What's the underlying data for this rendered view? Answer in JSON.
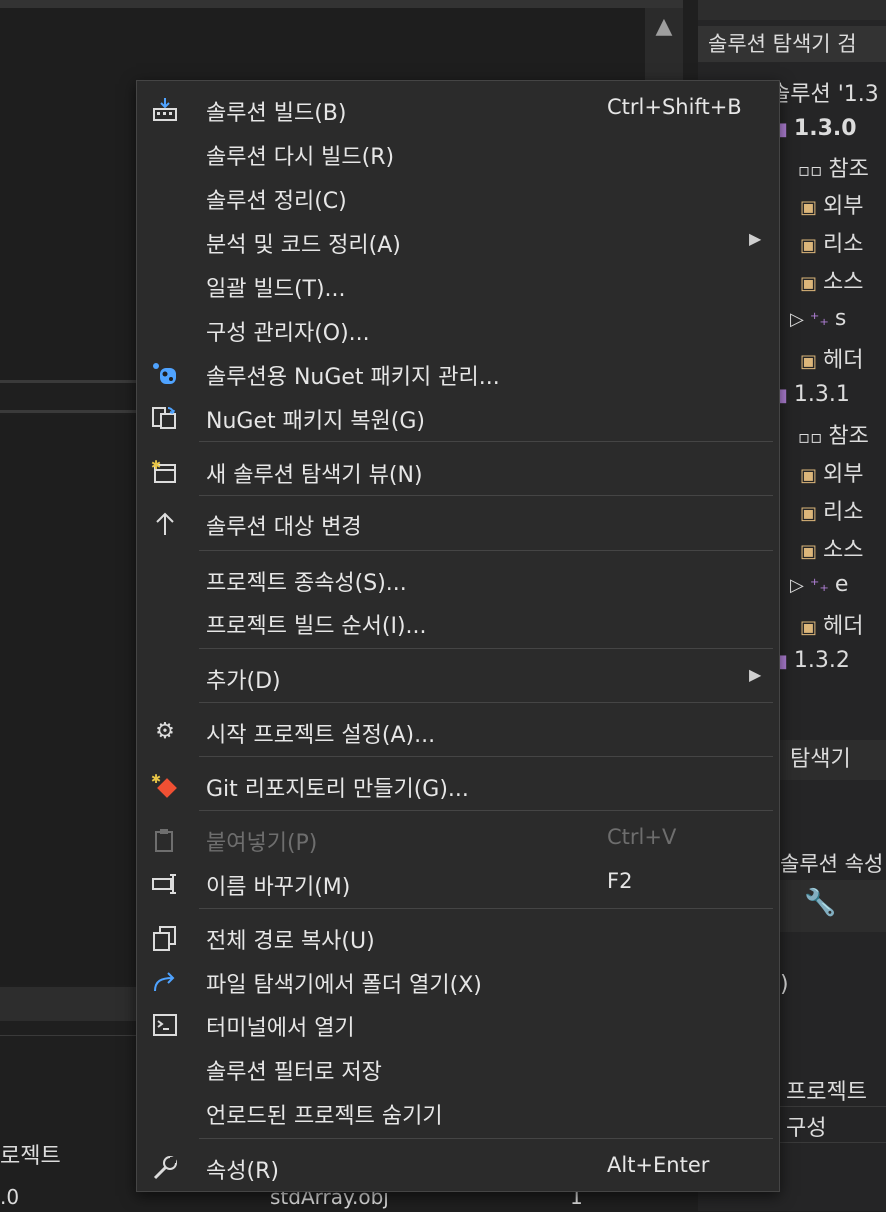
{
  "menu": {
    "items": [
      {
        "label": "솔루션 빌드(B)",
        "shortcut": "Ctrl+Shift+B",
        "icon": "build-solution-icon"
      },
      {
        "label": "솔루션 다시 빌드(R)"
      },
      {
        "label": "솔루션 정리(C)"
      },
      {
        "label": "분석 및 코드 정리(A)",
        "submenu": true
      },
      {
        "label": "일괄 빌드(T)..."
      },
      {
        "label": "구성 관리자(O)..."
      },
      {
        "label": "솔루션용 NuGet 패키지 관리...",
        "icon": "nuget-icon"
      },
      {
        "label": "NuGet 패키지 복원(G)",
        "icon": "restore-packages-icon"
      },
      {
        "label": "새 솔루션 탐색기 뷰(N)",
        "icon": "new-view-icon"
      },
      {
        "label": "솔루션 대상 변경",
        "icon": "arrow-up-icon"
      },
      {
        "label": "프로젝트 종속성(S)..."
      },
      {
        "label": "프로젝트 빌드 순서(I)..."
      },
      {
        "label": "추가(D)",
        "submenu": true
      },
      {
        "label": "시작 프로젝트 설정(A)...",
        "icon": "gear-icon"
      },
      {
        "label": "Git 리포지토리 만들기(G)...",
        "icon": "git-icon"
      },
      {
        "label": "붙여넣기(P)",
        "shortcut": "Ctrl+V",
        "icon": "paste-icon",
        "disabled": true
      },
      {
        "label": "이름 바꾸기(M)",
        "shortcut": "F2",
        "icon": "rename-icon"
      },
      {
        "label": "전체 경로 복사(U)",
        "icon": "copy-icon"
      },
      {
        "label": "파일 탐색기에서 폴더 열기(X)",
        "icon": "redo-arrow-icon"
      },
      {
        "label": "터미널에서 열기",
        "icon": "terminal-icon"
      },
      {
        "label": "솔루션 필터로 저장"
      },
      {
        "label": "언로드된 프로젝트 숨기기"
      },
      {
        "label": "속성(R)",
        "shortcut": "Alt+Enter",
        "icon": "wrench-icon"
      }
    ]
  },
  "solution_explorer": {
    "search_label": "솔루션 탐색기 검",
    "root": "솔루션 '1.3",
    "rows": [
      "1.3.0",
      "참조",
      "외부",
      "리소",
      "소스",
      "s",
      "헤더",
      "1.3.1",
      "참조",
      "외부",
      "리소",
      "소스",
      "e",
      "헤더",
      "1.3.2"
    ],
    "tab_label": "탐색기"
  },
  "properties": {
    "title": "솔루션 속성",
    "paren": ")",
    "rows": [
      "프로젝트",
      "구성"
    ]
  },
  "output": {
    "header": "로젝트",
    "row": {
      "c1": ".0",
      "c2": "stdArray.obj",
      "c3": "1"
    }
  }
}
